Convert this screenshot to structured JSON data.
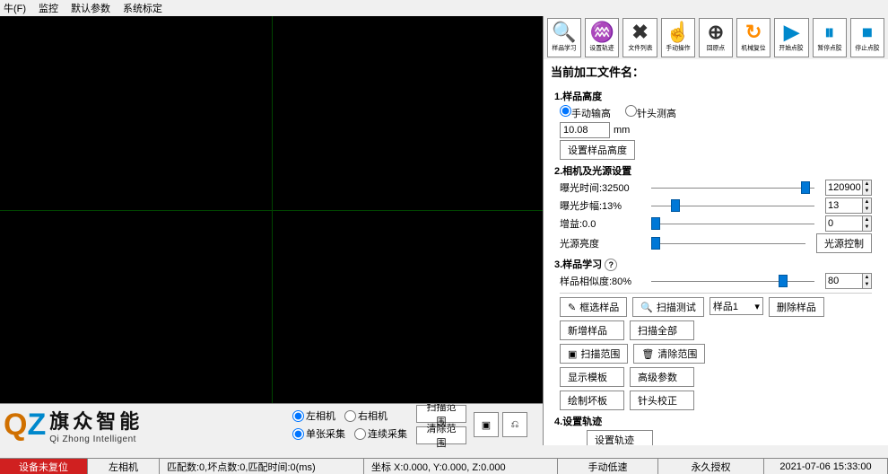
{
  "menu": [
    "牛(F)",
    "监控",
    "默认参数",
    "系统标定"
  ],
  "cam": {
    "left": "左相机",
    "right": "右相机",
    "single": "单张采集",
    "cont": "连续采集"
  },
  "scan": {
    "range": "扫描范围",
    "clear": "清除范围"
  },
  "toolbar": [
    {
      "ic": "🔍",
      "lbl": "样品学习",
      "c": "#ff8c00"
    },
    {
      "ic": "♒",
      "lbl": "设置轨迹",
      "c": "#0088cc"
    },
    {
      "ic": "✖",
      "lbl": "文件列表",
      "c": "#333"
    },
    {
      "ic": "☝",
      "lbl": "手动操作",
      "c": "#ff8c00"
    },
    {
      "ic": "⊕",
      "lbl": "回原点",
      "c": "#333"
    },
    {
      "ic": "↻",
      "lbl": "机械复位",
      "c": "#ff8c00"
    },
    {
      "ic": "▶",
      "lbl": "开始点胶",
      "c": "#0088cc"
    },
    {
      "ic": "⏸",
      "lbl": "暂停点胶",
      "c": "#0088cc"
    },
    {
      "ic": "⏹",
      "lbl": "停止点胶",
      "c": "#0088cc"
    }
  ],
  "filename_lbl": "当前加工文件名：",
  "g1": {
    "head": "1.样品高度",
    "manual": "手动输高",
    "needle": "针头测高",
    "val": "10.08",
    "unit": "mm",
    "setbtn": "设置样品高度"
  },
  "g2": {
    "head": "2.相机及光源设置",
    "exptime_lbl": "曝光时间:32500",
    "exptime_val": "120900",
    "expstep_lbl": "曝光步幅:13%",
    "expstep_val": "13",
    "gain_lbl": "增益:0.0",
    "gain_val": "0",
    "light_lbl": "光源亮度",
    "light_btn": "光源控制"
  },
  "g3": {
    "head": "3.样品学习",
    "sim_lbl": "样品相似度:80%",
    "sim_val": "80"
  },
  "ops": {
    "box": "框选样品",
    "scan": "扫描测试",
    "sample_sel": "样品1",
    "del": "删除样品",
    "add": "新增样品",
    "scanall": "扫描全部",
    "scanrange": "扫描范围",
    "clearrange": "清除范围",
    "showtpl": "显示模板",
    "adv": "高级参数",
    "maketpl": "绘制坏板",
    "cal": "针头校正"
  },
  "g4": {
    "head": "4.设置轨迹",
    "btn": "设置轨迹"
  },
  "status": {
    "dev": "设备未复位",
    "cam": "左相机",
    "match": "匹配数:0,坏点数:0,匹配时间:0(ms)",
    "coord": "坐标 X:0.000, Y:0.000, Z:0.000",
    "speed": "手动低速",
    "lic": "永久授权",
    "time": "2021-07-06 15:33:00"
  },
  "logo": {
    "cn": "旗众智能",
    "en": "Qi Zhong Intelligent"
  }
}
